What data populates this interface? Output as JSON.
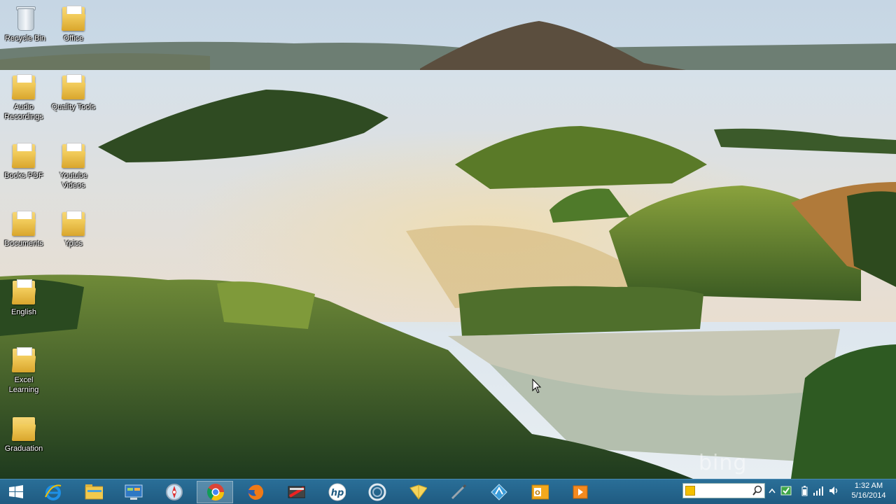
{
  "desktop": {
    "icons": [
      {
        "label": "Recycle Bin",
        "type": "recycle-bin"
      },
      {
        "label": "Office",
        "type": "folder"
      },
      {
        "label": "Audio\nRecordings",
        "type": "folder"
      },
      {
        "label": "Quality Tools",
        "type": "folder"
      },
      {
        "label": "Books PDF",
        "type": "folder"
      },
      {
        "label": "Youtube\nVideos",
        "type": "folder"
      },
      {
        "label": "Documents",
        "type": "folder"
      },
      {
        "label": "Ypics",
        "type": "folder"
      },
      {
        "label": "English",
        "type": "folder"
      },
      {
        "label": "Excel\nLearning",
        "type": "folder"
      },
      {
        "label": "Graduation",
        "type": "folder"
      }
    ],
    "watermark": "bing"
  },
  "taskbar": {
    "start_icon": "windows-logo-icon",
    "pinned": [
      {
        "name": "internet-explorer-icon",
        "active": false
      },
      {
        "name": "file-explorer-icon",
        "active": false
      },
      {
        "name": "control-panel-icon",
        "active": false
      },
      {
        "name": "safari-icon",
        "active": false
      },
      {
        "name": "chrome-icon",
        "active": true
      },
      {
        "name": "firefox-icon",
        "active": false
      },
      {
        "name": "video-editor-icon",
        "active": false
      },
      {
        "name": "hp-icon",
        "active": false
      },
      {
        "name": "media-player-icon",
        "active": false
      },
      {
        "name": "sticky-folder-icon",
        "active": false
      },
      {
        "name": "pen-tool-icon",
        "active": false
      },
      {
        "name": "vpn-app-icon",
        "active": false
      },
      {
        "name": "outlook-icon",
        "active": false
      },
      {
        "name": "player-app-icon",
        "active": false
      }
    ],
    "search": {
      "placeholder": ""
    },
    "tray": {
      "icons": [
        "show-hidden-icons-chevron-icon",
        "network-app-icon",
        "battery-icon",
        "signal-icon",
        "volume-icon"
      ]
    },
    "clock": {
      "time": "1:32 AM",
      "date": "5/16/2014"
    }
  },
  "colors": {
    "taskbar": "#1f5a80",
    "chrome_active": "#ffffff"
  }
}
